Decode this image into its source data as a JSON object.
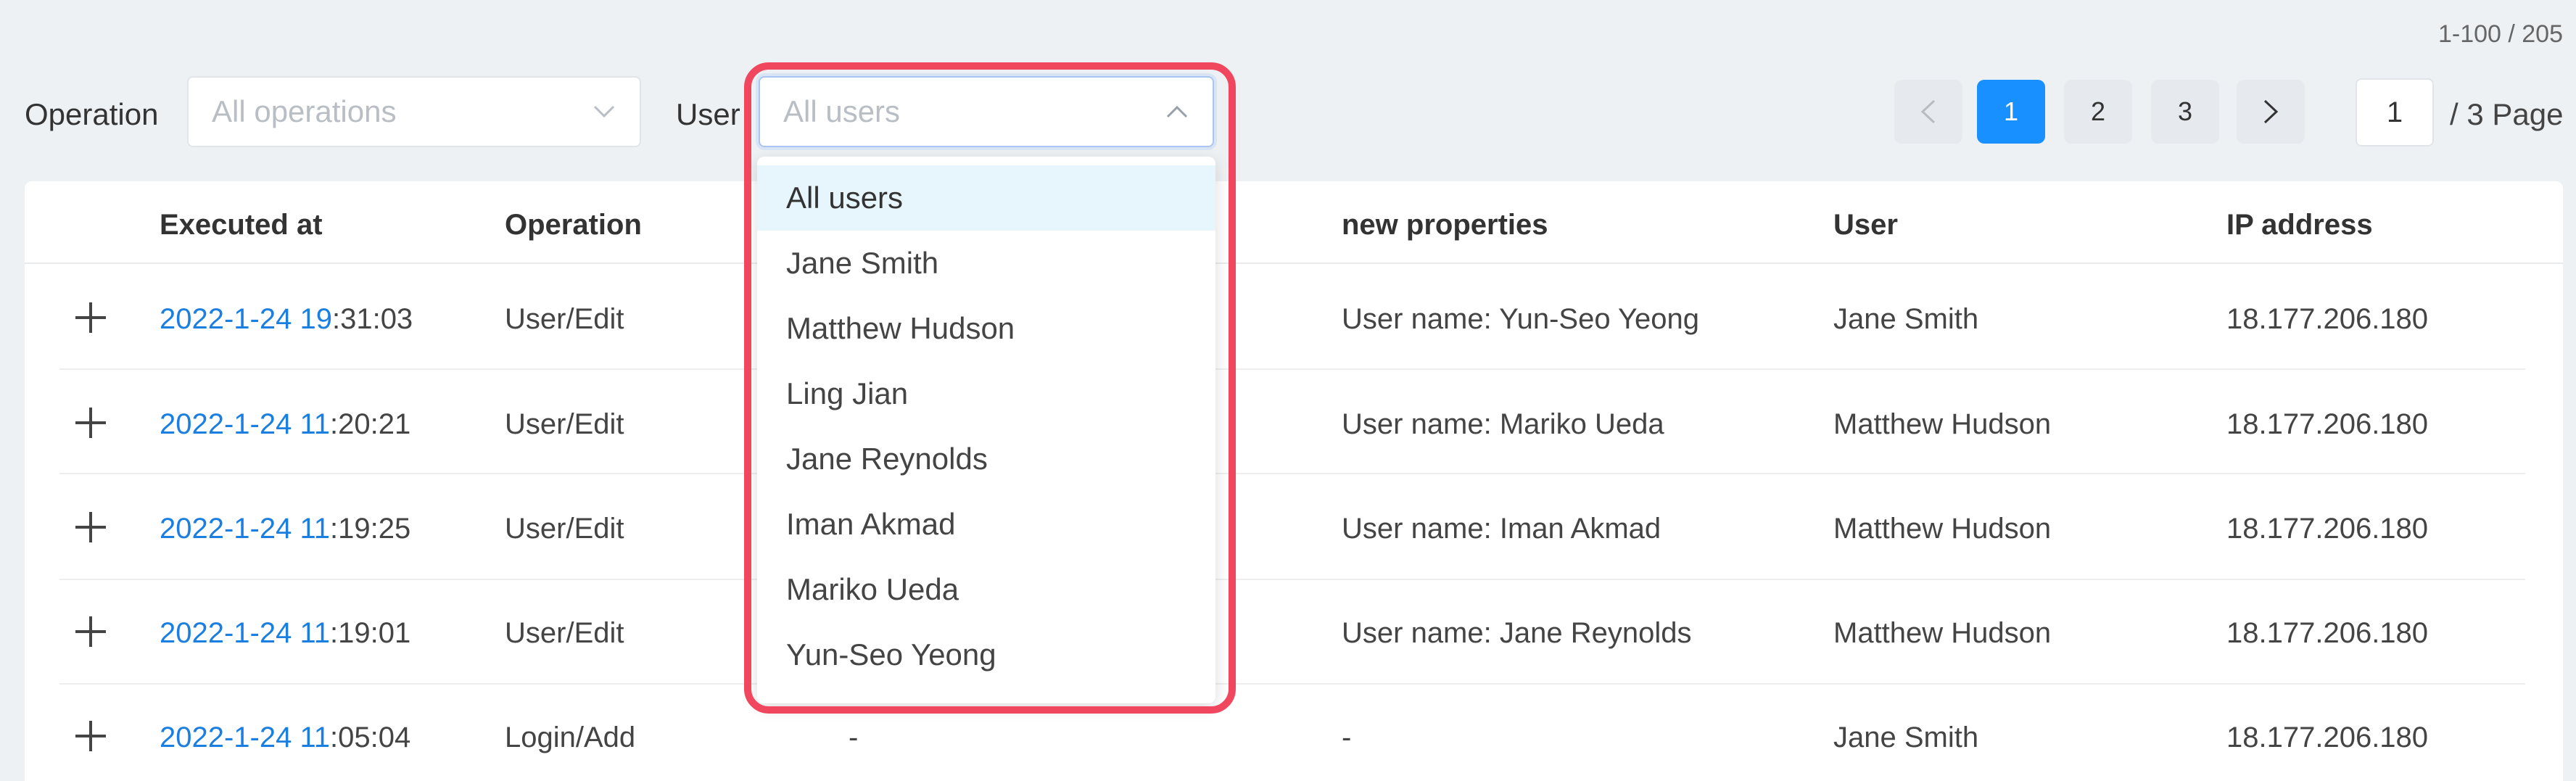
{
  "pagination": {
    "range_text": "1-100 / 205",
    "prev_icon": "chevron-left-icon",
    "next_icon": "chevron-right-icon",
    "pages": [
      "1",
      "2",
      "3"
    ],
    "current_page": "1",
    "page_input_value": "1",
    "total_pages_text": "/ 3 Page"
  },
  "filters": {
    "operation_label": "Operation",
    "operation_placeholder": "All operations",
    "user_label": "User",
    "user_placeholder": "All users",
    "user_options": [
      "All users",
      "Jane Smith",
      "Matthew Hudson",
      "Ling Jian",
      "Jane Reynolds",
      "Iman Akmad",
      "Mariko Ueda",
      "Yun-Seo Yeong"
    ],
    "selected_user_option": "All users"
  },
  "table": {
    "columns": [
      "Executed at",
      "Operation",
      "new properties",
      "User",
      "IP address"
    ],
    "rows": [
      {
        "date_part": "2022-1-24 19",
        "time_part": ":31:03",
        "operation": "User/Edit",
        "new_properties": "User name: Yun-Seo Yeong",
        "user": "Jane Smith",
        "ip": "18.177.206.180"
      },
      {
        "date_part": "2022-1-24 11",
        "time_part": ":20:21",
        "operation": "User/Edit",
        "new_properties": "User name: Mariko Ueda",
        "user": "Matthew Hudson",
        "ip": "18.177.206.180"
      },
      {
        "date_part": "2022-1-24 11",
        "time_part": ":19:25",
        "operation": "User/Edit",
        "new_properties": "User name: Iman Akmad",
        "user": "Matthew Hudson",
        "ip": "18.177.206.180"
      },
      {
        "date_part": "2022-1-24 11",
        "time_part": ":19:01",
        "operation": "User/Edit",
        "new_properties": "User name: Jane Reynolds",
        "user": "Matthew Hudson",
        "ip": "18.177.206.180"
      },
      {
        "date_part": "2022-1-24 11",
        "time_part": ":05:04",
        "operation": "Login/Add",
        "old_properties": "-",
        "new_properties": "-",
        "user": "Jane Smith",
        "ip": "18.177.206.180"
      }
    ]
  },
  "colors": {
    "accent": "#1890ff",
    "highlight_border": "#f0475f",
    "selected_option_bg": "#e6f6fc",
    "timestamp_link": "#1a7fe0"
  }
}
